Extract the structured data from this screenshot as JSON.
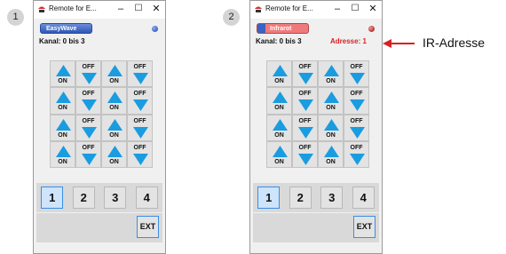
{
  "steps": [
    "1",
    "2"
  ],
  "windows": [
    {
      "title": "Remote for E...",
      "mode_label": "EasyWave",
      "mode": "easywave",
      "status_led_color": "#2a55c8",
      "kanal": "Kanal: 0 bis 3",
      "adresse": ""
    },
    {
      "title": "Remote for E...",
      "mode_label": "Infrarot",
      "mode": "infrarot",
      "status_led_color": "#a11a1a",
      "kanal": "Kanal: 0 bis 3",
      "adresse": "Adresse: 1"
    }
  ],
  "window_controls": {
    "minimize": "–",
    "maximize": "☐",
    "close": "✕"
  },
  "control_grid": {
    "rows": 4,
    "columns": [
      "on",
      "off",
      "on",
      "off"
    ],
    "on_label": "ON",
    "off_label": "OFF",
    "arrow_color": "#1a9ce0"
  },
  "channels": [
    "1",
    "2",
    "3",
    "4"
  ],
  "selected_channel": "1",
  "ext_label": "EXT",
  "callout": {
    "text": "IR-Adresse",
    "color": "#d92020"
  }
}
